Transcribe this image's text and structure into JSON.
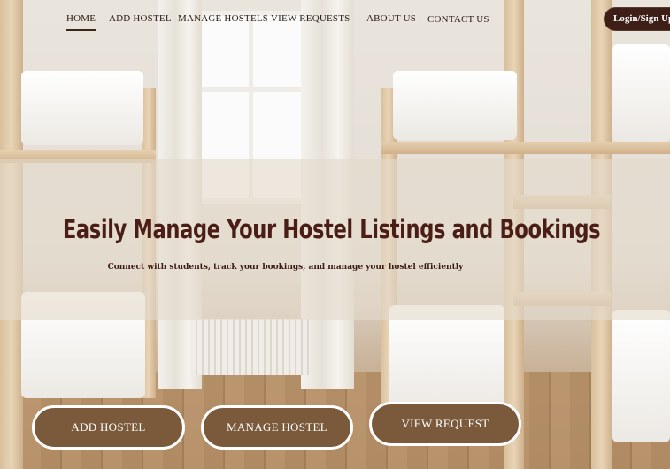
{
  "nav": {
    "items": [
      {
        "label": "HOME",
        "active": true
      },
      {
        "label": "ADD HOSTEL",
        "active": false
      },
      {
        "label": "MANAGE HOSTELS",
        "active": false
      },
      {
        "label": "VIEW REQUESTS",
        "active": false
      },
      {
        "label": "ABOUT US",
        "active": false
      },
      {
        "label": "CONTACT US",
        "active": false
      }
    ],
    "login_label": "Login/Sign Up"
  },
  "hero": {
    "title": "Easily Manage Your Hostel Listings and Bookings",
    "subtitle": "Connect with students, track your bookings, and manage your hostel efficiently"
  },
  "actions": [
    {
      "label": "ADD HOSTEL"
    },
    {
      "label": "MANAGE HOSTEL"
    },
    {
      "label": "VIEW REQUEST"
    }
  ],
  "colors": {
    "brand_dark": "#3e1f18",
    "title": "#4a1d16",
    "button_fill": "#7a5a3b",
    "button_border": "#ffffff"
  }
}
